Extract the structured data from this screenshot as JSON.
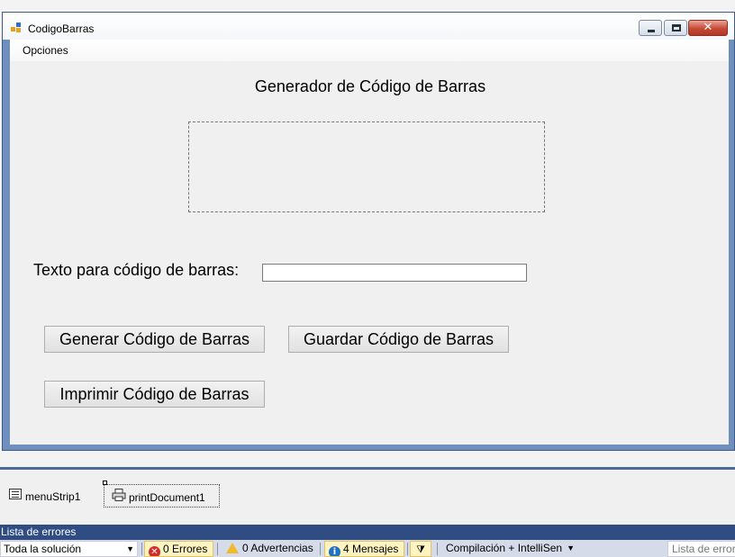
{
  "window": {
    "title": "CodigoBarras",
    "menu": [
      "Opciones"
    ]
  },
  "form": {
    "heading": "Generador de Código de Barras",
    "text_label": "Texto para código de barras:",
    "text_value": "",
    "buttons": {
      "generate": "Generar Código de Barras",
      "save": "Guardar Código de Barras",
      "print": "Imprimir Código de Barras"
    }
  },
  "tray": {
    "items": [
      "menuStrip1",
      "printDocument1"
    ]
  },
  "error_list": {
    "title": "Lista de errores",
    "scope": "Toda la solución",
    "errors": "0 Errores",
    "warnings": "0 Advertencias",
    "messages": "4 Mensajes",
    "build_filter": "Compilación + IntelliSen",
    "search_placeholder": "Lista de errores"
  },
  "colors": {
    "window_frame": "#6f8fbf",
    "close_button": "#c64a36",
    "panel_header": "#2f4d83"
  },
  "icons": [
    "app-icon",
    "minimize-icon",
    "maximize-icon",
    "close-icon",
    "menustrip-icon",
    "printer-icon",
    "error-icon",
    "warning-icon",
    "info-icon",
    "filter-icon",
    "chevron-down-icon"
  ]
}
